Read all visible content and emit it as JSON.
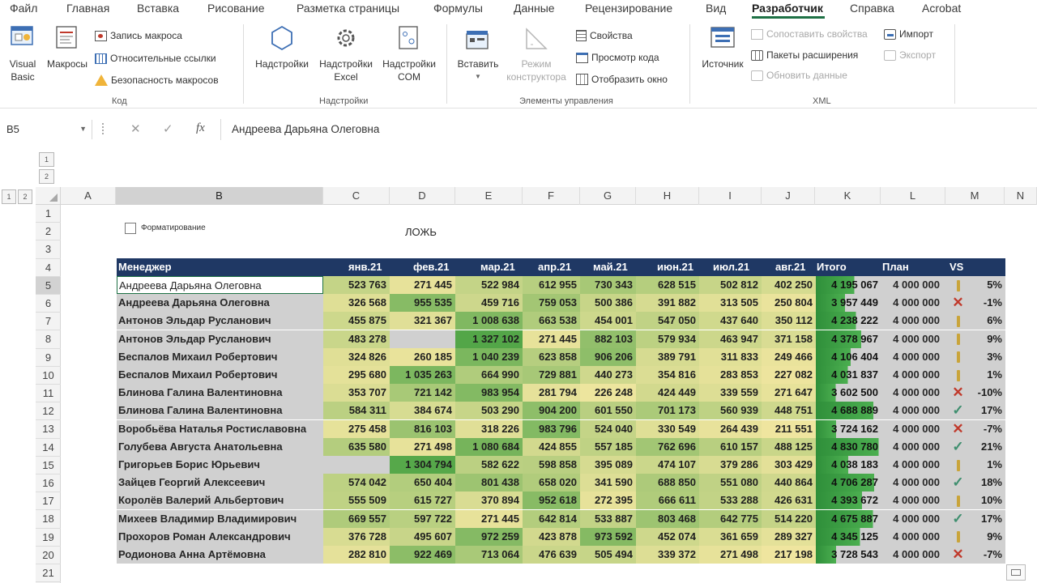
{
  "menu": {
    "tabs": [
      "Файл",
      "Главная",
      "Вставка",
      "Рисование",
      "Разметка страницы",
      "Формулы",
      "Данные",
      "Рецензирование",
      "Вид",
      "Разработчик",
      "Справка",
      "Acrobat"
    ]
  },
  "ribbon": {
    "code": {
      "visual_basic_1": "Visual",
      "visual_basic_2": "Basic",
      "macros": "Макросы",
      "record_macro": "Запись макроса",
      "relative_refs": "Относительные ссылки",
      "macro_security": "Безопасность макросов",
      "label": "Код"
    },
    "addins": {
      "addins": "Надстройки",
      "excel_addins_1": "Надстройки",
      "excel_addins_2": "Excel",
      "com_addins_1": "Надстройки",
      "com_addins_2": "COM",
      "label": "Надстройки"
    },
    "controls": {
      "insert": "Вставить",
      "design_mode_1": "Режим",
      "design_mode_2": "конструктора",
      "properties": "Свойства",
      "view_code": "Просмотр кода",
      "show_window": "Отобразить окно",
      "label": "Элементы управления"
    },
    "xml": {
      "source": "Источник",
      "map_properties": "Сопоставить свойства",
      "expansion_packs": "Пакеты расширения",
      "refresh_data": "Обновить данные",
      "import": "Импорт",
      "export": "Экспорт",
      "label": "XML"
    }
  },
  "formula_bar": {
    "name_box": "B5",
    "fx": "fx",
    "formula": "Андреева Дарьяна Олеговна"
  },
  "sheet": {
    "columns": [
      "A",
      "B",
      "C",
      "D",
      "E",
      "F",
      "G",
      "H",
      "I",
      "J",
      "K",
      "L",
      "M",
      "N"
    ],
    "rows": [
      "1",
      "2",
      "3",
      "4",
      "5",
      "6",
      "7",
      "8",
      "9",
      "10",
      "11",
      "12",
      "13",
      "14",
      "15",
      "16",
      "17",
      "18",
      "19",
      "20",
      "21"
    ],
    "checkbox_label": "Форматирование",
    "cell_D2": "ЛОЖЬ",
    "table": {
      "headers": [
        "Менеджер",
        "янв.21",
        "фев.21",
        "мар.21",
        "апр.21",
        "май.21",
        "июн.21",
        "июл.21",
        "авг.21",
        "Итого",
        "План",
        "VS"
      ],
      "rows": [
        {
          "name": "Андреева Дарьяна Олеговна",
          "v": [
            "523 763",
            "271 445",
            "522 984",
            "612 955",
            "730 343",
            "628 515",
            "502 812",
            "402 250"
          ],
          "total": "4 195 067",
          "plan": "4 000 000",
          "vs": "warn",
          "pct": "5%"
        },
        {
          "name": "Андреева Дарьяна Олеговна",
          "v": [
            "326 568",
            "955 535",
            "459 716",
            "759 053",
            "500 386",
            "391 882",
            "313 505",
            "250 804"
          ],
          "total": "3 957 449",
          "plan": "4 000 000",
          "vs": "cross",
          "pct": "-1%"
        },
        {
          "name": "Антонов Эльдар Русланович",
          "v": [
            "455 875",
            "321 367",
            "1 008 638",
            "663 538",
            "454 001",
            "547 050",
            "437 640",
            "350 112"
          ],
          "total": "4 238 222",
          "plan": "4 000 000",
          "vs": "warn",
          "pct": "6%"
        },
        {
          "name": "Антонов Эльдар Русланович",
          "v": [
            "483 278",
            "",
            "1 327 102",
            "271 445",
            "882 103",
            "579 934",
            "463 947",
            "371 158"
          ],
          "total": "4 378 967",
          "plan": "4 000 000",
          "vs": "warn",
          "pct": "9%"
        },
        {
          "name": "Беспалов Михаил Робертович",
          "v": [
            "324 826",
            "260 185",
            "1 040 239",
            "623 858",
            "906 206",
            "389 791",
            "311 833",
            "249 466"
          ],
          "total": "4 106 404",
          "plan": "4 000 000",
          "vs": "warn",
          "pct": "3%"
        },
        {
          "name": "Беспалов Михаил Робертович",
          "v": [
            "295 680",
            "1 035 263",
            "664 990",
            "729 881",
            "440 273",
            "354 816",
            "283 853",
            "227 082"
          ],
          "total": "4 031 837",
          "plan": "4 000 000",
          "vs": "warn",
          "pct": "1%"
        },
        {
          "name": "Блинова Галина Валентиновна",
          "v": [
            "353 707",
            "721 142",
            "983 954",
            "281 794",
            "226 248",
            "424 449",
            "339 559",
            "271 647"
          ],
          "total": "3 602 500",
          "plan": "4 000 000",
          "vs": "cross",
          "pct": "-10%"
        },
        {
          "name": "Блинова Галина Валентиновна",
          "v": [
            "584 311",
            "384 674",
            "503 290",
            "904 200",
            "601 550",
            "701 173",
            "560 939",
            "448 751"
          ],
          "total": "4 688 889",
          "plan": "4 000 000",
          "vs": "check",
          "pct": "17%"
        },
        {
          "name": "Воробьёва Наталья Ростиславовна",
          "v": [
            "275 458",
            "816 103",
            "318 226",
            "983 796",
            "524 040",
            "330 549",
            "264 439",
            "211 551"
          ],
          "total": "3 724 162",
          "plan": "4 000 000",
          "vs": "cross",
          "pct": "-7%"
        },
        {
          "name": "Голубева Августа Анатольевна",
          "v": [
            "635 580",
            "271 498",
            "1 080 684",
            "424 855",
            "557 185",
            "762 696",
            "610 157",
            "488 125"
          ],
          "total": "4 830 780",
          "plan": "4 000 000",
          "vs": "check",
          "pct": "21%"
        },
        {
          "name": "Григорьев Борис Юрьевич",
          "v": [
            "",
            "1 304 794",
            "582 622",
            "598 858",
            "395 089",
            "474 107",
            "379 286",
            "303 429"
          ],
          "total": "4 038 183",
          "plan": "4 000 000",
          "vs": "warn",
          "pct": "1%"
        },
        {
          "name": "Зайцев Георгий Алексеевич",
          "v": [
            "574 042",
            "650 404",
            "801 438",
            "658 020",
            "341 590",
            "688 850",
            "551 080",
            "440 864"
          ],
          "total": "4 706 287",
          "plan": "4 000 000",
          "vs": "check",
          "pct": "18%"
        },
        {
          "name": "Королёв Валерий Альбертович",
          "v": [
            "555 509",
            "615 727",
            "370 894",
            "952 618",
            "272 395",
            "666 611",
            "533 288",
            "426 631"
          ],
          "total": "4 393 672",
          "plan": "4 000 000",
          "vs": "warn",
          "pct": "10%"
        },
        {
          "name": "Михеев Владимир Владимирович",
          "v": [
            "669 557",
            "597 722",
            "271 445",
            "642 814",
            "533 887",
            "803 468",
            "642 775",
            "514 220"
          ],
          "total": "4 675 887",
          "plan": "4 000 000",
          "vs": "check",
          "pct": "17%"
        },
        {
          "name": "Прохоров Роман Александрович",
          "v": [
            "376 728",
            "495 607",
            "972 259",
            "423 878",
            "973 592",
            "452 074",
            "361 659",
            "289 327"
          ],
          "total": "4 345 125",
          "plan": "4 000 000",
          "vs": "warn",
          "pct": "9%"
        },
        {
          "name": "Родионова Анна Артёмовна",
          "v": [
            "282 810",
            "922 469",
            "713 064",
            "476 639",
            "505 494",
            "339 372",
            "271 498",
            "217 198"
          ],
          "total": "3 728 543",
          "plan": "4 000 000",
          "vs": "cross",
          "pct": "-7%"
        }
      ]
    }
  },
  "colors": {
    "header_bg": "#1f3864",
    "green_high": "#57a946",
    "yellow_low": "#f1e6a0",
    "check": "#3f8f6f",
    "cross": "#c0392b",
    "warn": "#c9a43a",
    "accent": "#1e7145"
  }
}
